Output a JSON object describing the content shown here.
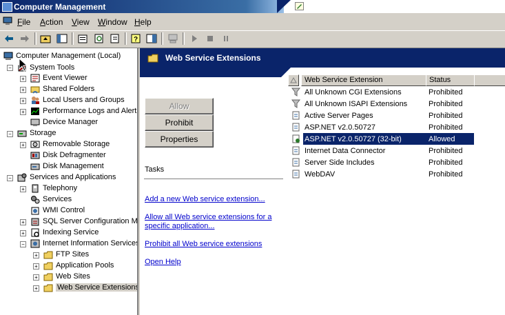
{
  "window": {
    "title": "Computer Management"
  },
  "menu": [
    {
      "label": "File",
      "u": "F",
      "rest": "ile"
    },
    {
      "label": "Action",
      "u": "A",
      "rest": "ction"
    },
    {
      "label": "View",
      "u": "V",
      "rest": "iew"
    },
    {
      "label": "Window",
      "u": "W",
      "rest": "indow"
    },
    {
      "label": "Help",
      "u": "H",
      "rest": "elp"
    }
  ],
  "tree": {
    "root": "Computer Management (Local)",
    "system_tools": "System Tools",
    "event_viewer": "Event Viewer",
    "shared_folders": "Shared Folders",
    "local_users": "Local Users and Groups",
    "perf_logs": "Performance Logs and Alerts",
    "device_manager": "Device Manager",
    "storage": "Storage",
    "removable_storage": "Removable Storage",
    "disk_defrag": "Disk Defragmenter",
    "disk_mgmt": "Disk Management",
    "services_apps": "Services and Applications",
    "telephony": "Telephony",
    "services": "Services",
    "wmi": "WMI Control",
    "sql": "SQL Server Configuration Manager",
    "indexing": "Indexing Service",
    "iis": "Internet Information Services",
    "ftp": "FTP Sites",
    "app_pools": "Application Pools",
    "web_sites": "Web Sites",
    "wse": "Web Service Extensions"
  },
  "panel": {
    "title": "Web Service Extensions",
    "buttons": {
      "allow": "Allow",
      "prohibit": "Prohibit",
      "properties": "Properties"
    },
    "tasks_label": "Tasks",
    "links": {
      "add": "Add a new Web service extension...",
      "allow_all_1": "Allow all Web service extensions for a",
      "allow_all_2": "specific application...",
      "prohibit_all": "Prohibit all Web service extensions",
      "help": "Open Help"
    }
  },
  "list": {
    "col_name": "Web Service Extension",
    "col_status": "Status",
    "rows": [
      {
        "name": "All Unknown CGI Extensions",
        "status": "Prohibited"
      },
      {
        "name": "All Unknown ISAPI Extensions",
        "status": "Prohibited"
      },
      {
        "name": "Active Server Pages",
        "status": "Prohibited"
      },
      {
        "name": "ASP.NET v2.0.50727",
        "status": "Prohibited"
      },
      {
        "name": "ASP.NET v2.0.50727 (32-bit)",
        "status": "Allowed"
      },
      {
        "name": "Internet Data Connector",
        "status": "Prohibited"
      },
      {
        "name": "Server Side Includes",
        "status": "Prohibited"
      },
      {
        "name": "WebDAV",
        "status": "Prohibited"
      }
    ]
  },
  "colors": {
    "title_bar": "#0a246a",
    "selection": "#0a246a",
    "link": "#0000cc",
    "face": "#d4d0c8"
  }
}
